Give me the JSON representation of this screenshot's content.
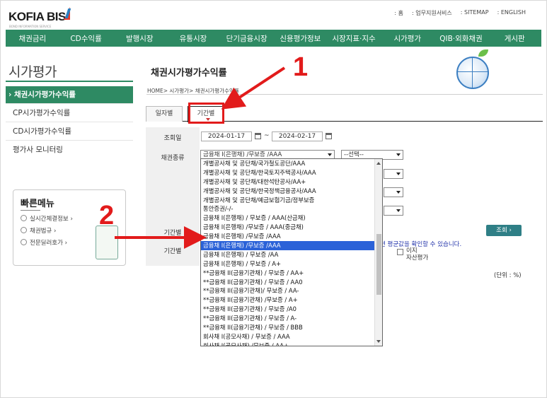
{
  "header": {
    "logo_text": "KOFIA BIS",
    "logo_sub": "BOND INFORMATION SERVICE",
    "utils": [
      ": 홈",
      ": 업무지원서비스",
      ": SITEMAP",
      ": ENGLISH"
    ]
  },
  "gnb": [
    "채권금리",
    "CD수익률",
    "발행시장",
    "유통시장",
    "단기금융시장",
    "신용평가정보",
    "시장지표·지수",
    "시가평가",
    "QIB·외화채권",
    "게시판"
  ],
  "sidebar": {
    "title": "시가평가",
    "items": [
      "› 채권시가평가수익률",
      "CP시가평가수익률",
      "CD시가평가수익률",
      "평가사 모니터링"
    ]
  },
  "quick_menu": {
    "title": "빠른메뉴",
    "links": [
      "실시간체결정보 ›",
      "채권법규 ›",
      "전문딜러호가 ›"
    ]
  },
  "main": {
    "title": "채권시가평가수익률",
    "breadcrumb": "HOME> 시가평가> 채권시가평가수익률",
    "tabs": [
      "일자별",
      "기간별"
    ]
  },
  "form": {
    "label_date": "조회일",
    "label_type": "채권종류",
    "label_period": "기간별",
    "label_period2": "기간별",
    "date_from": "2024-01-17",
    "date_to": "2024-02-17",
    "tilde": "~",
    "bond_select": "금융채 I(은행채) /무보증 /AAA",
    "second_select": "--선택--",
    "search_button": "조회 ›",
    "notice": "련 평균값을 확인할 수 있습니다.",
    "checkbox_label": "이지\n자산평가",
    "unit": "(단위 : %)"
  },
  "dropdown": {
    "selected_index": 9,
    "options": [
      "개별공사채 및 공단채/국가철도공단/AAA",
      "개별공사채 및 공단채/한국토지주택공사/AAA",
      "개별공사채 및 공단채/대한석탄공사/AA+",
      "개별공사채 및 공단채/한국정책금융공사/AAA",
      "개별공사채 및 공단채/예금보험기금/정부보증",
      "통안증권/-/-",
      "금융채 I(은행채) / 무보증 / AAA(산금채)",
      "금융채 I(은행채) /무보증 / AAA(중금채)",
      "금융채 I(은행채) /무보증 /AAA",
      "금융채 I(은행채) /무보증 /AAA",
      "금융채 I(은행채) / 무보증 /AA",
      "금융채 I(은행채) / 무보증 / A+",
      "**금융채 II(금융기관채) / 무보증 / AA+",
      "**금융채 II(금융기관채) / 무보증 / AA0",
      "**금융채 II(금융기관채)/ 무보증 / AA-",
      "**금융채 II(금융기관채) /무보증 / A+",
      "**금융채 II(금융기관채) / 무보증 /A0",
      "**금융채 II(금융기관채) / 무보증 / A-",
      "**금융채 II(금융기관채) / 무보증 / BBB",
      "회사채 I(공모사채) / 무보증 / AAA",
      "회사채 I(공모사채) /무보증 / AA+"
    ]
  },
  "annotations": {
    "num1": "1",
    "num2": "2",
    "color": "#e21b1b"
  },
  "colors": {
    "brand_green": "#2e8a63",
    "highlight_blue": "#2b62d8",
    "search_teal": "#2f7f86"
  }
}
